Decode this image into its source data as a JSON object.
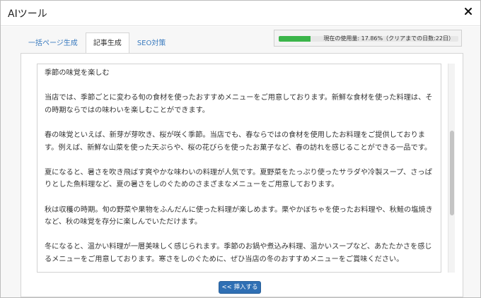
{
  "modal": {
    "title": "AIツール"
  },
  "tabs": [
    {
      "label": "一括ページ生成",
      "active": false
    },
    {
      "label": "記事生成",
      "active": true
    },
    {
      "label": "SEO対策",
      "active": false
    }
  ],
  "usage": {
    "percent": 17.86,
    "text": "現在の使用量: 17.86%（クリアまでの日数:22日）"
  },
  "editor": {
    "content": "季節の味覚を楽しむ\n\n当店では、季節ごとに変わる旬の食材を使ったおすすめメニューをご用意しております。新鮮な食材を使った料理は、その時期ならではの味わいを楽しむことができます。\n\n春の味覚といえば、新芽が芽吹き、桜が咲く季節。当店でも、春ならではの食材を使用したお料理をご提供しております。例えば、新鮮な山菜を使った天ぷらや、桜の花びらを使ったお菓子など、春の訪れを感じることができる一品です。\n\n夏になると、暑さを吹き飛ばす爽やかな味わいの料理が人気です。夏野菜をたっぷり使ったサラダや冷製スープ、さっぱりとした魚料理など、夏の暑さをしのぐためのさまざまなメニューをご用意しております。\n\n秋は収穫の時期。旬の野菜や果物をふんだんに使った料理が楽しめます。栗やかぼちゃを使ったお料理や、秋鮭の塩焼きなど、秋の味覚を存分に楽しんでいただけます。\n\n冬になると、温かい料理が一層美味しく感じられます。季節のお鍋や煮込み料理、温かいスープなど、あたたかさを感じるメニューをご用意しております。寒さをしのぐために、ぜひ当店の冬のおすすめメニューをご賞味ください。\n\n当店のおすすめメニューは、厳選された季節の食材を使用し、その時期ならではの味わいをお楽しみいただけます。季節を感じながら、美味しい料理を堪能してみませんか？ぜひ一度、当店にお越しください。心よりお待ちしておりま"
  },
  "actions": {
    "insert_label": "<< 挿入する"
  },
  "colors": {
    "accent": "#2f6fb4",
    "progress": "#3bb54a",
    "tab_link": "#3a7bbf"
  },
  "icons": {
    "close": "close-icon"
  }
}
